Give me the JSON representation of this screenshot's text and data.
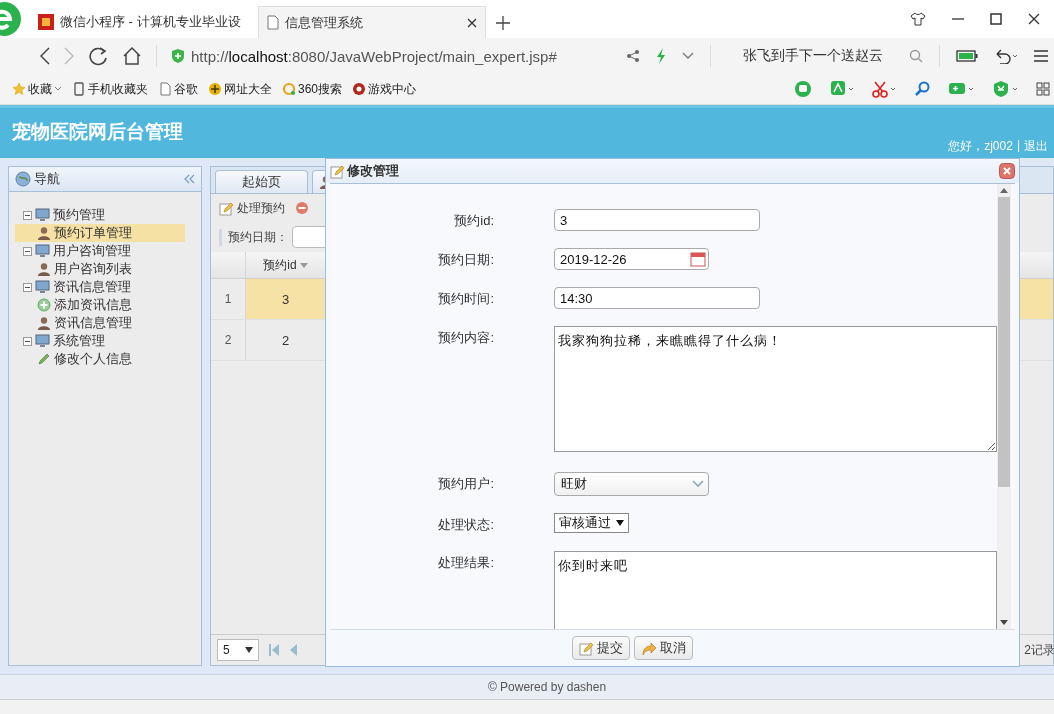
{
  "browser": {
    "tabs": [
      {
        "title": "微信小程序 - 计算机专业毕业设",
        "selected": false
      },
      {
        "title": "信息管理系统",
        "selected": true
      }
    ],
    "url": "http://**localhost**:8080/JavaWebProject/main_expert.jsp#",
    "search_text": "张飞到手下一个送赵云",
    "bookmarks": [
      {
        "label": "收藏",
        "kind": "star"
      },
      {
        "label": "手机收藏夹",
        "kind": "phone"
      },
      {
        "label": "谷歌",
        "kind": "page"
      },
      {
        "label": "网址大全",
        "kind": "globe"
      },
      {
        "label": "360搜索",
        "kind": "ring"
      },
      {
        "label": "游戏中心",
        "kind": "game"
      }
    ]
  },
  "app": {
    "title": "宠物医院网后台管理",
    "greeting": "您好，zj002",
    "separator": "|",
    "logout": "退出"
  },
  "nav": {
    "title": "导航",
    "items": [
      {
        "label": "预约管理",
        "expanded": true,
        "children": [
          {
            "label": "预约订单管理",
            "kind": "person",
            "selected": true
          }
        ]
      },
      {
        "label": "用户咨询管理",
        "expanded": true,
        "children": [
          {
            "label": "用户咨询列表",
            "kind": "person",
            "selected": false
          }
        ]
      },
      {
        "label": "资讯信息管理",
        "expanded": true,
        "children": [
          {
            "label": "添加资讯信息",
            "kind": "add",
            "selected": false
          },
          {
            "label": "资讯信息管理",
            "kind": "person",
            "selected": false
          }
        ]
      },
      {
        "label": "系统管理",
        "expanded": true,
        "children": [
          {
            "label": "修改个人信息",
            "kind": "pencil",
            "selected": false
          }
        ]
      }
    ]
  },
  "content": {
    "tabs": [
      {
        "kind": "text",
        "label": "起始页"
      },
      {
        "kind": "icon"
      }
    ],
    "toolbar": [
      {
        "kind": "edit",
        "label": "处理预约"
      },
      {
        "kind": "remove"
      }
    ],
    "filter_label": "预约日期：",
    "grid": {
      "columns": [
        "预约id"
      ],
      "rows": [
        {
          "number": "1",
          "values": [
            "3"
          ],
          "selected": true
        },
        {
          "number": "2",
          "values": [
            "2"
          ],
          "selected": false
        }
      ]
    },
    "pager": {
      "page_size": "5",
      "summary": "2记录"
    }
  },
  "dialog": {
    "title": "修改管理",
    "fields": [
      {
        "label": "预约id:",
        "kind": "text",
        "value": "3"
      },
      {
        "label": "预约日期:",
        "kind": "date",
        "value": "2019-12-26"
      },
      {
        "label": "预约时间:",
        "kind": "text",
        "value": "14:30"
      },
      {
        "label": "预约内容:",
        "kind": "textarea",
        "value": "我家狗狗拉稀，来瞧瞧得了什么病！"
      },
      {
        "label": "预约用户:",
        "kind": "combo",
        "value": "旺财"
      },
      {
        "label": "处理状态:",
        "kind": "select",
        "value": "审核通过"
      },
      {
        "label": "处理结果:",
        "kind": "textarea",
        "value": "你到时来吧"
      }
    ],
    "buttons": [
      {
        "kind": "edit",
        "label": "提交"
      },
      {
        "kind": "undo",
        "label": "取消"
      }
    ]
  },
  "footer": "© Powered by dashen"
}
